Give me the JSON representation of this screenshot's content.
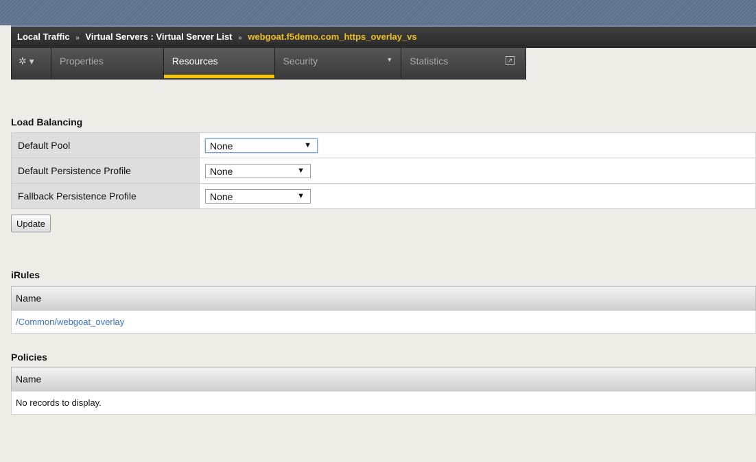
{
  "breadcrumb": {
    "parts": [
      "Local Traffic",
      "Virtual Servers : Virtual Server List"
    ],
    "separator": "»",
    "current": "webgoat.f5demo.com_https_overlay_vs"
  },
  "tabs": {
    "gear_label": "✲ ▾",
    "properties": "Properties",
    "resources": "Resources",
    "security": "Security",
    "statistics": "Statistics",
    "active": "Resources"
  },
  "load_balancing": {
    "title": "Load Balancing",
    "rows": [
      {
        "label": "Default Pool",
        "value": "None"
      },
      {
        "label": "Default Persistence Profile",
        "value": "None"
      },
      {
        "label": "Fallback Persistence Profile",
        "value": "None"
      }
    ],
    "update_label": "Update"
  },
  "irules": {
    "title": "iRules",
    "column": "Name",
    "rows": [
      "/Common/webgoat_overlay"
    ]
  },
  "policies": {
    "title": "Policies",
    "column": "Name",
    "empty": "No records to display."
  },
  "colors": {
    "accent": "#f5c20c",
    "link": "#3a6fc4",
    "breadcrumb_current": "#f0c020"
  }
}
